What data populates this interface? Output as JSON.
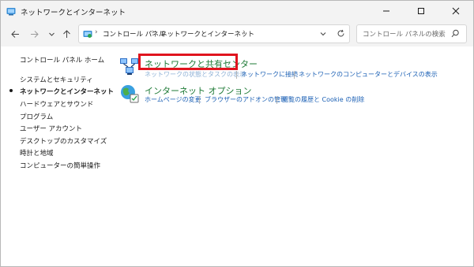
{
  "window": {
    "title": "ネットワークとインターネット"
  },
  "address": {
    "crumbs": [
      "コントロール パネル",
      "ネットワークとインターネット"
    ],
    "separator": "›"
  },
  "search": {
    "placeholder": "コントロール パネルの検索"
  },
  "sidebar": {
    "home": "コントロール パネル ホーム",
    "items": [
      {
        "label": "システムとセキュリティ"
      },
      {
        "label": "ネットワークとインターネット",
        "current": true
      },
      {
        "label": "ハードウェアとサウンド"
      },
      {
        "label": "プログラム"
      },
      {
        "label": "ユーザー アカウント"
      },
      {
        "label": "デスクトップのカスタマイズ"
      },
      {
        "label": "時計と地域"
      },
      {
        "label": "コンピューターの簡単操作"
      }
    ]
  },
  "main": {
    "categories": [
      {
        "title": "ネットワークと共有センター",
        "links": [
          "ネットワークの状態とタスクの表示",
          "ネットワークに接続",
          "ネットワークのコンピューターとデバイスの表示"
        ]
      },
      {
        "title": "インターネット オプション",
        "links": [
          "ホームページの変更",
          "ブラウザーのアドオンの管理",
          "閲覧の履歴と Cookie の削除"
        ]
      }
    ]
  },
  "colors": {
    "highlight": "#e0141e",
    "category_title": "#1e7a36",
    "link": "#1a5fb4"
  }
}
